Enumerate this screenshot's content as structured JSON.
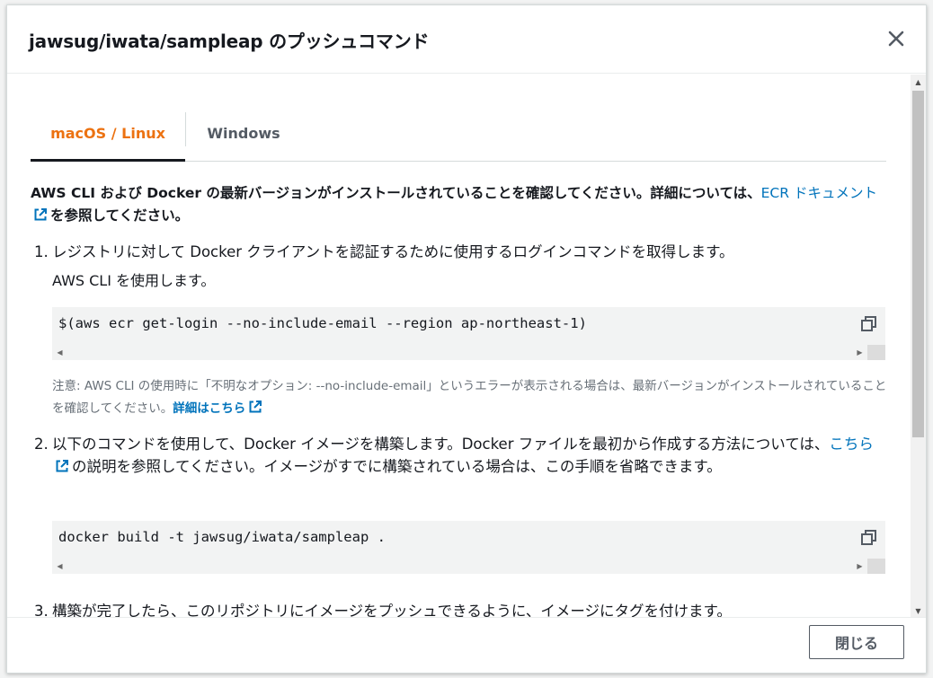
{
  "modal": {
    "title": "jawsug/iwata/sampleap のプッシュコマンド",
    "close_icon": "close-icon",
    "footer_close_label": "閉じる"
  },
  "tabs": [
    {
      "label": "macOS / Linux",
      "active": true
    },
    {
      "label": "Windows",
      "active": false
    }
  ],
  "intro": {
    "text": "AWS CLI および Docker の最新バージョンがインストールされていることを確認してください。詳細については、",
    "link": "ECR ドキュメント",
    "suffix": "を参照してください。"
  },
  "steps": [
    {
      "number": "1.",
      "text": "レジストリに対して Docker クライアントを認証するために使用するログインコマンドを取得します。",
      "sub_text": "AWS CLI を使用します。",
      "code": "$(aws ecr get-login --no-include-email --region ap-northeast-1)",
      "note": "注意: AWS CLI の使用時に「不明なオプション: --no-include-email」というエラーが表示される場合は、最新バージョンがインストールされていることを確認してください。",
      "note_link": "詳細はこちら"
    },
    {
      "number": "2.",
      "text_before": "以下のコマンドを使用して、Docker イメージを構築します。Docker ファイルを最初から作成する方法については、",
      "link": "こちら",
      "text_after": "の説明を参照してください。イメージがすでに構築されている場合は、この手順を省略できます。",
      "code": "docker build -t jawsug/iwata/sampleap ."
    },
    {
      "number": "3.",
      "text": "構築が完了したら、このリポジトリにイメージをプッシュできるように、イメージにタグを付けます。"
    }
  ],
  "colors": {
    "active_tab": "#ec7211",
    "link": "#0073bb",
    "code_bg": "#f2f3f3"
  }
}
